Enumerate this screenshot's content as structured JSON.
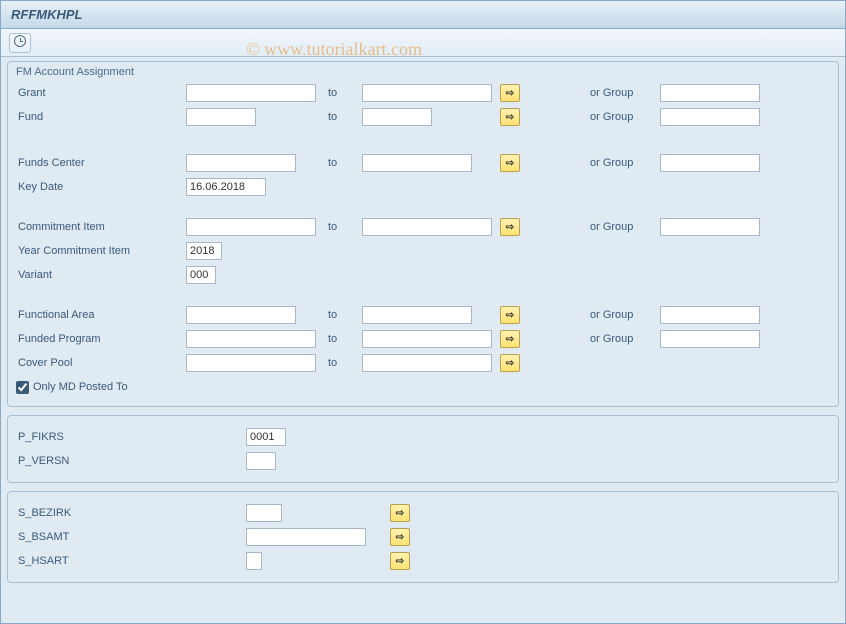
{
  "window": {
    "title": "RFFMKHPL"
  },
  "watermark": "© www.tutorialkart.com",
  "icons": {
    "execute": "clock-icon"
  },
  "section1": {
    "title": "FM Account Assignment",
    "toLabel": "to",
    "orGroupLabel": "or Group",
    "rows": {
      "grant": {
        "label": "Grant",
        "from": "",
        "to": "",
        "group": ""
      },
      "fund": {
        "label": "Fund",
        "from": "",
        "to": "",
        "group": ""
      },
      "fundsCtr": {
        "label": "Funds Center",
        "from": "",
        "to": "",
        "group": ""
      },
      "keyDate": {
        "label": "Key Date",
        "value": "16.06.2018"
      },
      "commitItem": {
        "label": "Commitment Item",
        "from": "",
        "to": "",
        "group": ""
      },
      "yearCI": {
        "label": "Year Commitment Item",
        "value": "2018"
      },
      "variant": {
        "label": "Variant",
        "value": "000"
      },
      "funcArea": {
        "label": "Functional Area",
        "from": "",
        "to": "",
        "group": ""
      },
      "fundProg": {
        "label": "Funded Program",
        "from": "",
        "to": "",
        "group": ""
      },
      "coverPool": {
        "label": "Cover Pool",
        "from": "",
        "to": ""
      },
      "onlyMD": {
        "label": "Only MD Posted To",
        "checked": true
      }
    }
  },
  "section2": {
    "pFikrs": {
      "label": "P_FIKRS",
      "value": "0001"
    },
    "pVersn": {
      "label": "P_VERSN",
      "value": ""
    }
  },
  "section3": {
    "sBezirk": {
      "label": "S_BEZIRK",
      "from": ""
    },
    "sBsamt": {
      "label": "S_BSAMT",
      "from": ""
    },
    "sHsart": {
      "label": "S_HSART",
      "from": ""
    }
  }
}
